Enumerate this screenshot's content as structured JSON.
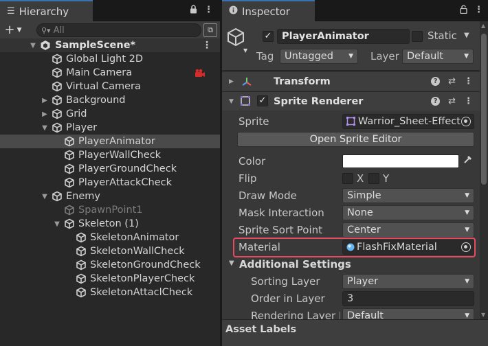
{
  "hierarchy": {
    "tab_label": "Hierarchy",
    "search_placeholder": "All",
    "scene_name": "SampleScene*",
    "items": [
      {
        "label": "Global Light 2D",
        "depth": 1
      },
      {
        "label": "Main Camera",
        "depth": 1
      },
      {
        "label": "Virtual Camera",
        "depth": 1
      },
      {
        "label": "Background",
        "depth": 1,
        "expandable": true,
        "expanded": false
      },
      {
        "label": "Grid",
        "depth": 1,
        "expandable": true,
        "expanded": false
      },
      {
        "label": "Player",
        "depth": 1,
        "expandable": true,
        "expanded": true
      },
      {
        "label": "PlayerAnimator",
        "depth": 2,
        "selected": true
      },
      {
        "label": "PlayerWallCheck",
        "depth": 2
      },
      {
        "label": "PlayerGroundCheck",
        "depth": 2
      },
      {
        "label": "PlayerAttackCheck",
        "depth": 2
      },
      {
        "label": "Enemy",
        "depth": 1,
        "expandable": true,
        "expanded": true
      },
      {
        "label": "SpawnPoint1",
        "depth": 2,
        "inactive": true
      },
      {
        "label": "Skeleton (1)",
        "depth": 2,
        "expandable": true,
        "expanded": true
      },
      {
        "label": "SkeletonAnimator",
        "depth": 3
      },
      {
        "label": "SkeletonWallCheck",
        "depth": 3
      },
      {
        "label": "SkeletonGroundCheck",
        "depth": 3
      },
      {
        "label": "SkeletonPlayerCheck",
        "depth": 3
      },
      {
        "label": "SkeletonAttaclCheck",
        "depth": 3
      }
    ]
  },
  "inspector": {
    "tab_label": "Inspector",
    "object_name": "PlayerAnimator",
    "static_label": "Static",
    "tag_label": "Tag",
    "tag_value": "Untagged",
    "layer_label": "Layer",
    "layer_value": "Default",
    "transform_title": "Transform",
    "sprite_renderer_title": "Sprite Renderer",
    "props": {
      "sprite_label": "Sprite",
      "sprite_value": "Warrior_Sheet-Effect",
      "open_sprite_editor": "Open Sprite Editor",
      "color_label": "Color",
      "color_value": "#ffffff",
      "flip_label": "Flip",
      "flip_x": "X",
      "flip_y": "Y",
      "draw_mode_label": "Draw Mode",
      "draw_mode_value": "Simple",
      "mask_interaction_label": "Mask Interaction",
      "mask_interaction_value": "None",
      "sprite_sort_point_label": "Sprite Sort Point",
      "sprite_sort_point_value": "Center",
      "material_label": "Material",
      "material_value": "FlashFixMaterial",
      "additional_settings": "Additional Settings",
      "sorting_layer_label": "Sorting Layer",
      "sorting_layer_value": "Player",
      "order_in_layer_label": "Order in Layer",
      "order_in_layer_value": "3",
      "rendering_layer_label": "Rendering Layer M",
      "rendering_layer_value": "Default"
    },
    "asset_labels": "Asset Labels"
  },
  "colors": {
    "accent_tab": "#3a72b0",
    "highlight": "#e84a5f",
    "selected_row": "#4a4a4a"
  }
}
